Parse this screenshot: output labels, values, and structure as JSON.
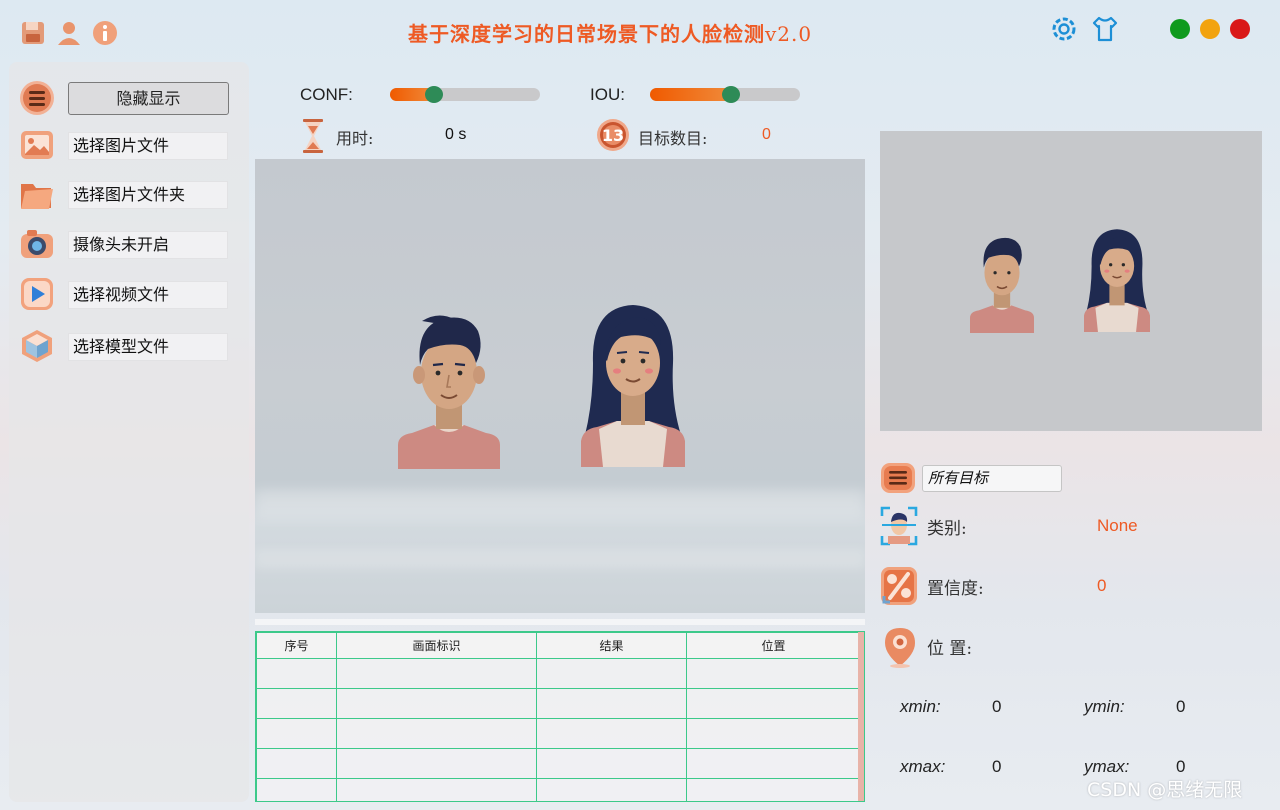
{
  "window": {
    "title": "基于深度学习的日常场景下的人脸检测",
    "version": "v2.0",
    "icons": [
      "save-icon",
      "user-icon",
      "info-icon",
      "settings-gear-icon",
      "skin-shirt-icon"
    ],
    "controls": {
      "green": "#0f9a1e",
      "yellow": "#f2a30f",
      "red": "#d91818"
    }
  },
  "sidebar": {
    "toggle_label": "隐藏显示",
    "items": [
      {
        "label": "选择图片文件",
        "icon": "image-icon"
      },
      {
        "label": "选择图片文件夹",
        "icon": "folder-icon"
      },
      {
        "label": "摄像头未开启",
        "icon": "camera-icon"
      },
      {
        "label": "选择视频文件",
        "icon": "play-video-icon"
      },
      {
        "label": "选择模型文件",
        "icon": "model-cube-icon"
      }
    ]
  },
  "params": {
    "conf_label": "CONF:",
    "conf_value": 0.29,
    "iou_label": "IOU:",
    "iou_value": 0.54
  },
  "stats": {
    "time_label": "用时:",
    "time_value": "0 s",
    "count_label": "目标数目:",
    "count_value": "0"
  },
  "table": {
    "headers": [
      "序号",
      "画面标识",
      "结果",
      "位置"
    ],
    "rows": [
      [
        "",
        "",
        "",
        ""
      ],
      [
        "",
        "",
        "",
        ""
      ],
      [
        "",
        "",
        "",
        ""
      ],
      [
        "",
        "",
        "",
        ""
      ],
      [
        "",
        "",
        "",
        ""
      ]
    ]
  },
  "details": {
    "filter_value": "所有目标",
    "class_label": "类别:",
    "class_value": "None",
    "conf_label": "置信度:",
    "conf_value": "0",
    "pos_label": "位 置:",
    "xmin_label": "xmin:",
    "xmin_value": "0",
    "ymin_label": "ymin:",
    "ymin_value": "0",
    "xmax_label": "xmax:",
    "xmax_value": "0",
    "ymax_label": "ymax:",
    "ymax_value": "0"
  },
  "watermark": "CSDN @思绪无限",
  "colors": {
    "accent": "#ee5a24",
    "grid": "#3cc98a",
    "knob": "#2e8b57"
  }
}
